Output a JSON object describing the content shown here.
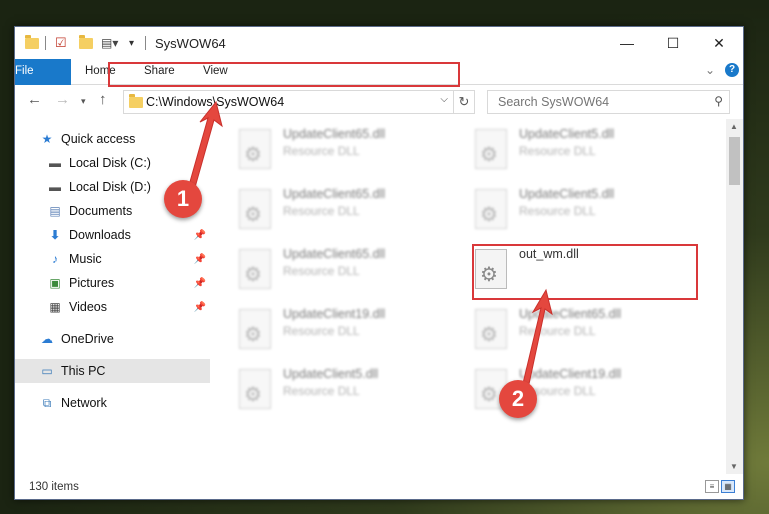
{
  "window": {
    "title": "SysWOW64",
    "minimize": "—",
    "maximize": "☐",
    "close": "✕"
  },
  "ribbon": {
    "tabs": [
      "File",
      "Home",
      "Share",
      "View"
    ],
    "expand": "⌄",
    "help": "?"
  },
  "address": {
    "path": "C:\\Windows\\SysWOW64",
    "search_placeholder": "Search SysWOW64"
  },
  "nav": {
    "items": [
      {
        "label": "Quick access",
        "icon": "star-icon"
      },
      {
        "label": "Local Disk (C:)",
        "icon": "drive-icon"
      },
      {
        "label": "Local Disk (D:)",
        "icon": "drive-icon"
      },
      {
        "label": "Documents",
        "icon": "documents-icon"
      },
      {
        "label": "Downloads",
        "icon": "download-icon"
      },
      {
        "label": "Music",
        "icon": "music-icon"
      },
      {
        "label": "Pictures",
        "icon": "pictures-icon"
      },
      {
        "label": "Videos",
        "icon": "videos-icon"
      },
      {
        "label": "OneDrive",
        "icon": "cloud-icon"
      },
      {
        "label": "This PC",
        "icon": "computer-icon"
      },
      {
        "label": "Network",
        "icon": "network-icon"
      }
    ]
  },
  "files": [
    {
      "name": "UpdateClient65.dll",
      "type": "Resource DLL"
    },
    {
      "name": "UpdateClient5.dll",
      "type": "Resource DLL"
    },
    {
      "name": "UpdateClient65.dll",
      "type": "Resource DLL"
    },
    {
      "name": "UpdateClient5.dll",
      "type": "Resource DLL"
    },
    {
      "name": "UpdateClient65.dll",
      "type": "Resource DLL"
    },
    {
      "name": "out_wm.dll",
      "type": ""
    },
    {
      "name": "UpdateClient19.dll",
      "type": "Resource DLL"
    },
    {
      "name": "UpdateClient65.dll",
      "type": "Resource DLL"
    },
    {
      "name": "UpdateClient5.dll",
      "type": "Resource DLL"
    },
    {
      "name": "UpdateClient19.dll",
      "type": "Resource DLL"
    }
  ],
  "status": {
    "item_count": "130 items"
  },
  "annotations": {
    "step1": "1",
    "step2": "2",
    "color": "#e4473e"
  }
}
